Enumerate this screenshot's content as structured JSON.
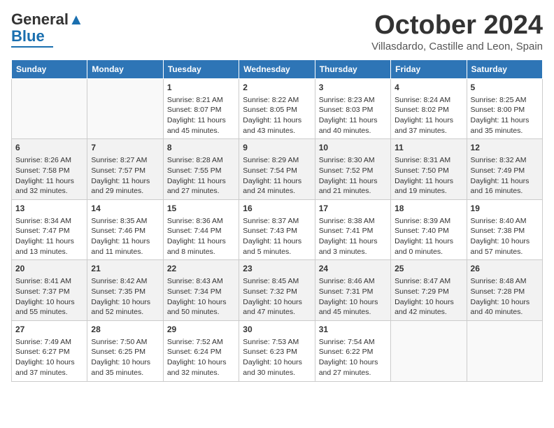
{
  "header": {
    "logo_general": "General",
    "logo_blue": "Blue",
    "month": "October 2024",
    "location": "Villasdardo, Castille and Leon, Spain"
  },
  "weekdays": [
    "Sunday",
    "Monday",
    "Tuesday",
    "Wednesday",
    "Thursday",
    "Friday",
    "Saturday"
  ],
  "weeks": [
    [
      {
        "day": "",
        "content": ""
      },
      {
        "day": "",
        "content": ""
      },
      {
        "day": "1",
        "content": "Sunrise: 8:21 AM\nSunset: 8:07 PM\nDaylight: 11 hours and 45 minutes."
      },
      {
        "day": "2",
        "content": "Sunrise: 8:22 AM\nSunset: 8:05 PM\nDaylight: 11 hours and 43 minutes."
      },
      {
        "day": "3",
        "content": "Sunrise: 8:23 AM\nSunset: 8:03 PM\nDaylight: 11 hours and 40 minutes."
      },
      {
        "day": "4",
        "content": "Sunrise: 8:24 AM\nSunset: 8:02 PM\nDaylight: 11 hours and 37 minutes."
      },
      {
        "day": "5",
        "content": "Sunrise: 8:25 AM\nSunset: 8:00 PM\nDaylight: 11 hours and 35 minutes."
      }
    ],
    [
      {
        "day": "6",
        "content": "Sunrise: 8:26 AM\nSunset: 7:58 PM\nDaylight: 11 hours and 32 minutes."
      },
      {
        "day": "7",
        "content": "Sunrise: 8:27 AM\nSunset: 7:57 PM\nDaylight: 11 hours and 29 minutes."
      },
      {
        "day": "8",
        "content": "Sunrise: 8:28 AM\nSunset: 7:55 PM\nDaylight: 11 hours and 27 minutes."
      },
      {
        "day": "9",
        "content": "Sunrise: 8:29 AM\nSunset: 7:54 PM\nDaylight: 11 hours and 24 minutes."
      },
      {
        "day": "10",
        "content": "Sunrise: 8:30 AM\nSunset: 7:52 PM\nDaylight: 11 hours and 21 minutes."
      },
      {
        "day": "11",
        "content": "Sunrise: 8:31 AM\nSunset: 7:50 PM\nDaylight: 11 hours and 19 minutes."
      },
      {
        "day": "12",
        "content": "Sunrise: 8:32 AM\nSunset: 7:49 PM\nDaylight: 11 hours and 16 minutes."
      }
    ],
    [
      {
        "day": "13",
        "content": "Sunrise: 8:34 AM\nSunset: 7:47 PM\nDaylight: 11 hours and 13 minutes."
      },
      {
        "day": "14",
        "content": "Sunrise: 8:35 AM\nSunset: 7:46 PM\nDaylight: 11 hours and 11 minutes."
      },
      {
        "day": "15",
        "content": "Sunrise: 8:36 AM\nSunset: 7:44 PM\nDaylight: 11 hours and 8 minutes."
      },
      {
        "day": "16",
        "content": "Sunrise: 8:37 AM\nSunset: 7:43 PM\nDaylight: 11 hours and 5 minutes."
      },
      {
        "day": "17",
        "content": "Sunrise: 8:38 AM\nSunset: 7:41 PM\nDaylight: 11 hours and 3 minutes."
      },
      {
        "day": "18",
        "content": "Sunrise: 8:39 AM\nSunset: 7:40 PM\nDaylight: 11 hours and 0 minutes."
      },
      {
        "day": "19",
        "content": "Sunrise: 8:40 AM\nSunset: 7:38 PM\nDaylight: 10 hours and 57 minutes."
      }
    ],
    [
      {
        "day": "20",
        "content": "Sunrise: 8:41 AM\nSunset: 7:37 PM\nDaylight: 10 hours and 55 minutes."
      },
      {
        "day": "21",
        "content": "Sunrise: 8:42 AM\nSunset: 7:35 PM\nDaylight: 10 hours and 52 minutes."
      },
      {
        "day": "22",
        "content": "Sunrise: 8:43 AM\nSunset: 7:34 PM\nDaylight: 10 hours and 50 minutes."
      },
      {
        "day": "23",
        "content": "Sunrise: 8:45 AM\nSunset: 7:32 PM\nDaylight: 10 hours and 47 minutes."
      },
      {
        "day": "24",
        "content": "Sunrise: 8:46 AM\nSunset: 7:31 PM\nDaylight: 10 hours and 45 minutes."
      },
      {
        "day": "25",
        "content": "Sunrise: 8:47 AM\nSunset: 7:29 PM\nDaylight: 10 hours and 42 minutes."
      },
      {
        "day": "26",
        "content": "Sunrise: 8:48 AM\nSunset: 7:28 PM\nDaylight: 10 hours and 40 minutes."
      }
    ],
    [
      {
        "day": "27",
        "content": "Sunrise: 7:49 AM\nSunset: 6:27 PM\nDaylight: 10 hours and 37 minutes."
      },
      {
        "day": "28",
        "content": "Sunrise: 7:50 AM\nSunset: 6:25 PM\nDaylight: 10 hours and 35 minutes."
      },
      {
        "day": "29",
        "content": "Sunrise: 7:52 AM\nSunset: 6:24 PM\nDaylight: 10 hours and 32 minutes."
      },
      {
        "day": "30",
        "content": "Sunrise: 7:53 AM\nSunset: 6:23 PM\nDaylight: 10 hours and 30 minutes."
      },
      {
        "day": "31",
        "content": "Sunrise: 7:54 AM\nSunset: 6:22 PM\nDaylight: 10 hours and 27 minutes."
      },
      {
        "day": "",
        "content": ""
      },
      {
        "day": "",
        "content": ""
      }
    ]
  ]
}
